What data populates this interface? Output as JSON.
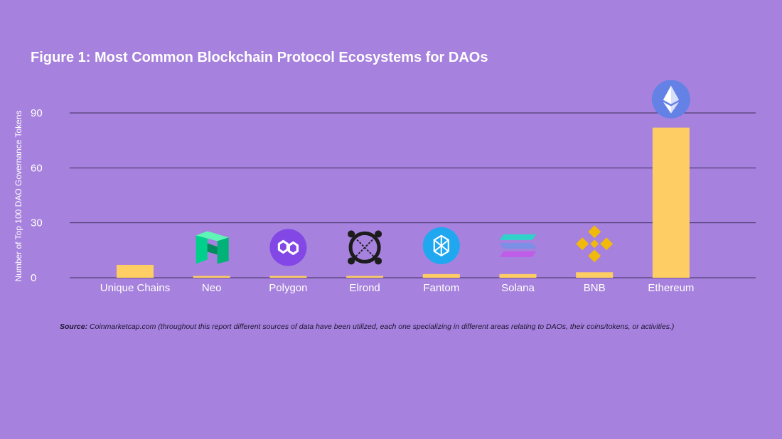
{
  "chart_data": {
    "type": "bar",
    "title": "Figure 1: Most Common Blockchain Protocol Ecosystems for DAOs",
    "xlabel": "",
    "ylabel": "Number of Top 100 DAO Governance Tokens",
    "categories": [
      "Unique Chains",
      "Neo",
      "Polygon",
      "Elrond",
      "Fantom",
      "Solana",
      "BNB",
      "Ethereum"
    ],
    "values": [
      7,
      1,
      1,
      1,
      2,
      2,
      3,
      82
    ],
    "ylim": [
      0,
      90
    ],
    "yticks": [
      0,
      30,
      60,
      90
    ],
    "grid": true,
    "legend": "none"
  },
  "icons": [
    "",
    "neo-icon",
    "polygon-icon",
    "elrond-icon",
    "fantom-icon",
    "solana-icon",
    "bnb-icon",
    "ethereum-icon"
  ],
  "colors": {
    "background": "#a681dd",
    "bar": "#fecd64",
    "grid": "#3d2f5c",
    "text": "#ffffff"
  },
  "source": {
    "label": "Source:",
    "text": " Coinmarketcap.com (throughout this report different sources of data have been utilized, each one specializing in different areas relating to DAOs, their coins/tokens, or activities.)"
  }
}
